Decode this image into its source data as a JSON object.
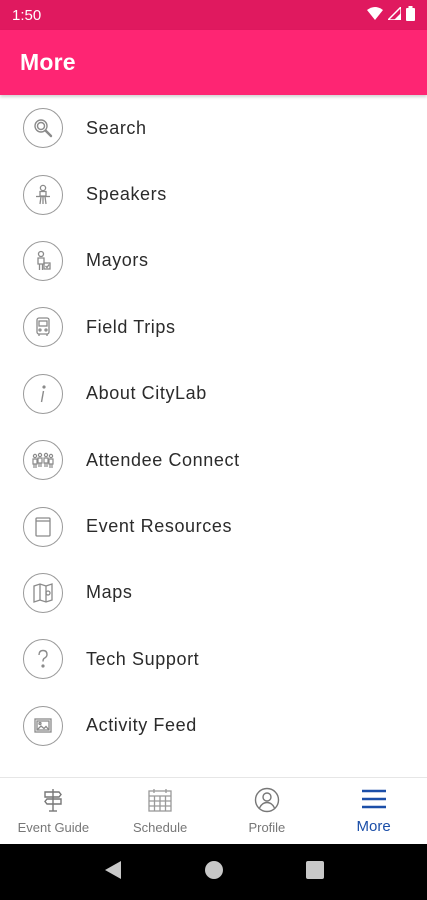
{
  "status_bar": {
    "time": "1:50",
    "icons": [
      "wifi-icon",
      "signal-icon",
      "battery-icon"
    ]
  },
  "app_bar": {
    "title": "More"
  },
  "menu": {
    "items": [
      {
        "label": "Search",
        "icon": "search-icon"
      },
      {
        "label": "Speakers",
        "icon": "speaker-icon"
      },
      {
        "label": "Mayors",
        "icon": "mayors-icon"
      },
      {
        "label": "Field Trips",
        "icon": "bus-icon"
      },
      {
        "label": "About CityLab",
        "icon": "info-icon"
      },
      {
        "label": "Attendee Connect",
        "icon": "attendees-icon"
      },
      {
        "label": "Event Resources",
        "icon": "document-icon"
      },
      {
        "label": "Maps",
        "icon": "map-icon"
      },
      {
        "label": "Tech Support",
        "icon": "question-icon"
      },
      {
        "label": "Activity Feed",
        "icon": "photo-icon"
      }
    ]
  },
  "bottom_nav": {
    "items": [
      {
        "label": "Event Guide",
        "icon": "signpost-icon",
        "active": false
      },
      {
        "label": "Schedule",
        "icon": "calendar-icon",
        "active": false
      },
      {
        "label": "Profile",
        "icon": "profile-icon",
        "active": false
      },
      {
        "label": "More",
        "icon": "hamburger-icon",
        "active": true
      }
    ]
  },
  "colors": {
    "status_bar": "#e0195f",
    "app_bar": "#fe2573",
    "active_nav": "#1b4ea8",
    "inactive_nav": "#777777"
  }
}
